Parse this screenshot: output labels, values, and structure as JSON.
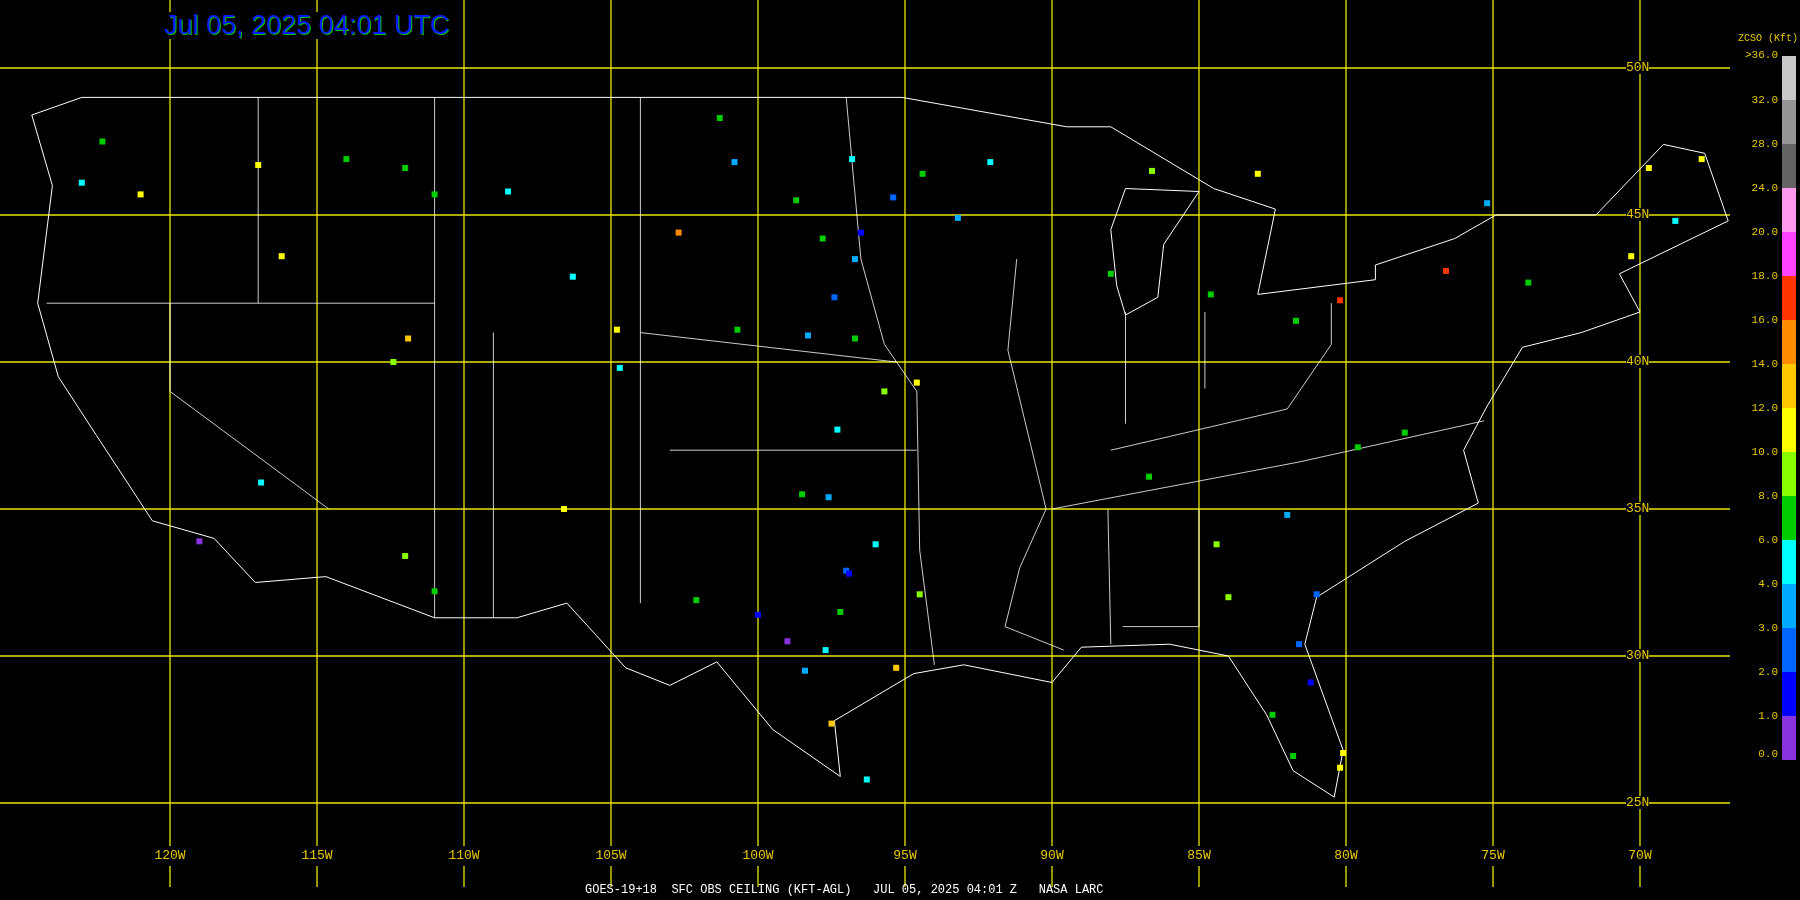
{
  "title": "Jul 05, 2025 04:01 UTC",
  "latitude_labels": [
    "50N",
    "45N",
    "40N",
    "35N",
    "30N",
    "25N"
  ],
  "longitude_labels": [
    "120W",
    "115W",
    "110W",
    "105W",
    "100W",
    "95W",
    "90W",
    "85W",
    "80W",
    "75W",
    "70W"
  ],
  "legend": {
    "title": "ZCSO (Kft)",
    "labels": [
      ">36.0",
      "32.0",
      "28.0",
      "24.0",
      "20.0",
      "18.0",
      "16.0",
      "14.0",
      "12.0",
      "10.0",
      "8.0",
      "6.0",
      "4.0",
      "3.0",
      "2.0",
      "1.0",
      "0.0"
    ],
    "bins": [
      {
        "color": "#c8c8c8"
      },
      {
        "color": "#969696"
      },
      {
        "color": "#646464"
      },
      {
        "color": "#ff99ee"
      },
      {
        "color": "#ff44ff"
      },
      {
        "color": "#ff3300"
      },
      {
        "color": "#ff8c00"
      },
      {
        "color": "#ffc800"
      },
      {
        "color": "#ffff00"
      },
      {
        "color": "#88ff00"
      },
      {
        "color": "#00cc00"
      },
      {
        "color": "#00ffff"
      },
      {
        "color": "#00aaff"
      },
      {
        "color": "#0066ff"
      },
      {
        "color": "#0000ff"
      },
      {
        "color": "#8833dd"
      }
    ]
  },
  "caption": "GOES-19+18  SFC OBS CEILING (KFT-AGL)   JUL 05, 2025 04:01 Z   NASA LARC"
}
